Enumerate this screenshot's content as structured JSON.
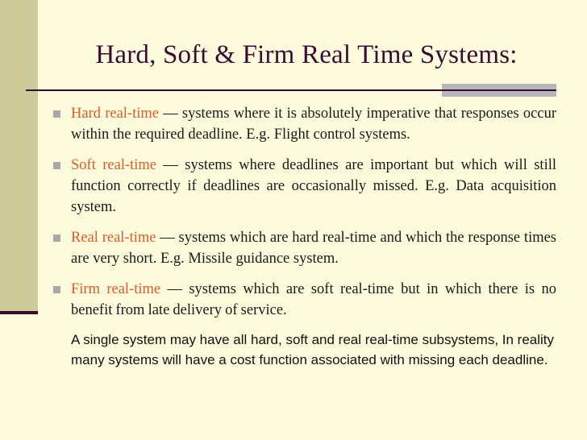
{
  "slide": {
    "title": "Hard, Soft & Firm Real Time Systems:",
    "background_color": "#fcfcdc",
    "accent_band_color": "#cdcb99",
    "title_color": "#3b0b33",
    "rule_color": "#3b0b2e",
    "gray_accent_color": "#b6b6b6",
    "bullet_marker_color": "#a9a9a9",
    "lead_in_color": "#e05a2b"
  },
  "bullets": [
    {
      "lead": "Hard real-time",
      "rest": " — systems where it is absolutely imperative that responses occur within the required deadline. E.g. Flight control systems."
    },
    {
      "lead": "Soft real-time",
      "rest": " — systems where deadlines are important but which will still function correctly if deadlines are occasionally missed. E.g. Data acquisition system."
    },
    {
      "lead": "Real real-time",
      "rest": " — systems which are hard real-time and which the response times are very short. E.g. Missile guidance system."
    },
    {
      "lead": "Firm real-time",
      "rest": " — systems which are soft real-time but in which there is no benefit from late delivery of service."
    }
  ],
  "closing": {
    "text": "A single system may have all hard, soft and real real-time subsystems, In reality many systems will have a cost function associated with missing each deadline."
  }
}
